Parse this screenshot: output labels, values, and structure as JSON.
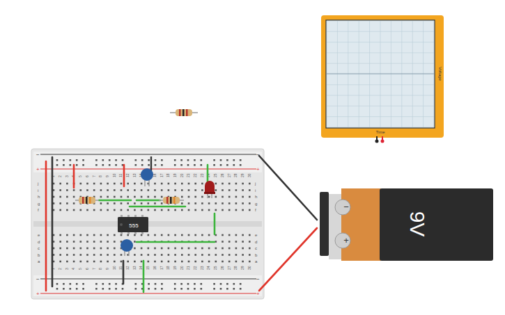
{
  "breadboard": {
    "columns": [
      "1",
      "2",
      "3",
      "4",
      "5",
      "6",
      "7",
      "8",
      "9",
      "10",
      "11",
      "12",
      "13",
      "14",
      "15",
      "16",
      "17",
      "18",
      "19",
      "20",
      "21",
      "22",
      "23",
      "24",
      "25",
      "26",
      "27",
      "28",
      "29",
      "30"
    ],
    "rows_top": [
      "j",
      "i",
      "h",
      "g",
      "f"
    ],
    "rows_bottom": [
      "e",
      "d",
      "c",
      "b",
      "a"
    ],
    "rail_negative": "−",
    "rail_positive": "+"
  },
  "chip": {
    "label": "555"
  },
  "battery": {
    "label": "9V",
    "negative": "−",
    "positive": "+"
  },
  "oscilloscope": {
    "x_label": "Time",
    "y_label": "Voltage"
  },
  "wires": [
    {
      "color": "#e0352b"
    },
    {
      "color": "#333333"
    },
    {
      "color": "#e0352b"
    },
    {
      "color": "#e0352b"
    },
    {
      "color": "#3db53d"
    },
    {
      "color": "#3db53d"
    },
    {
      "color": "#3db53d"
    },
    {
      "color": "#3db53d"
    },
    {
      "color": "#3db53d"
    },
    {
      "color": "#3db53d"
    },
    {
      "color": "#333333"
    },
    {
      "color": "#3db53d"
    },
    {
      "color": "#333333"
    },
    {
      "color": "#e0352b"
    }
  ]
}
